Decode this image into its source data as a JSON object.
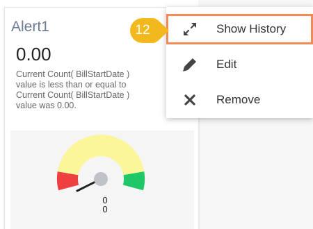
{
  "card": {
    "title": "Alert1",
    "value": "0.00",
    "description_lines": [
      "Current Count( BillStartDate )",
      "value is less than or equal to",
      "Current Count( BillStartDate )",
      "value was 0.00."
    ],
    "gauge": {
      "value_label": "0",
      "target_label": "0",
      "colors": {
        "red": "#ee3f41",
        "yellow": "#fbf69a",
        "green": "#1fc766"
      }
    }
  },
  "step_badge": {
    "number": "12",
    "color": "#f2b91f"
  },
  "context_menu": {
    "items": [
      {
        "label": "Show History",
        "icon": "expand-arrows-icon"
      },
      {
        "label": "Edit",
        "icon": "pencil-icon"
      },
      {
        "label": "Remove",
        "icon": "close-x-icon"
      }
    ],
    "highlight_color": "#f08a57"
  }
}
